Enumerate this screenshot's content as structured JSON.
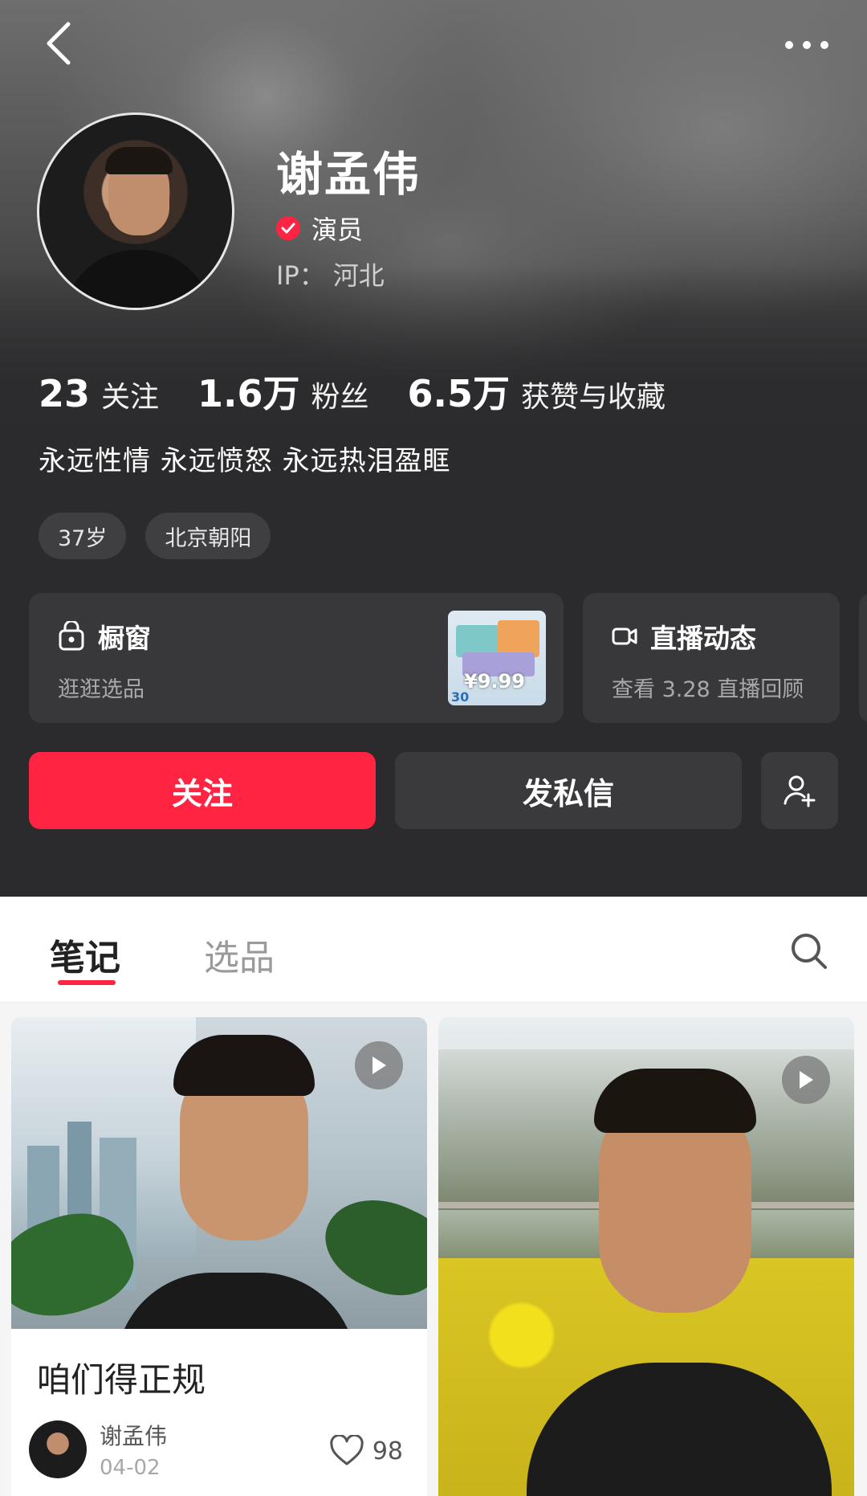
{
  "profile": {
    "name": "谢孟伟",
    "role": "演员",
    "ip_label": "IP：",
    "ip_value": "河北",
    "bio": "永远性情 永远愤怒 永远热泪盈眶",
    "tags": [
      "37岁",
      "北京朝阳"
    ]
  },
  "stats": [
    {
      "num": "23",
      "label": "关注"
    },
    {
      "num": "1.6万",
      "label": "粉丝"
    },
    {
      "num": "6.5万",
      "label": "获赞与收藏"
    }
  ],
  "cards": {
    "shop": {
      "title": "橱窗",
      "subtitle": "逛逛选品",
      "price": "¥9.99",
      "product_text": "30"
    },
    "live": {
      "title": "直播动态",
      "subtitle": "查看 3.28 直播回顾"
    }
  },
  "actions": {
    "follow": "关注",
    "message": "发私信"
  },
  "tabs": [
    {
      "label": "笔记",
      "active": true
    },
    {
      "label": "选品",
      "active": false
    }
  ],
  "notes": [
    {
      "title": "咱们得正规",
      "author": "谢孟伟",
      "date": "04-02",
      "likes": "98"
    }
  ],
  "colors": {
    "accent": "#ff2442",
    "header_bg": "#2b2b2d"
  },
  "icons": [
    "back-arrow-icon",
    "more-dots-icon",
    "verified-icon",
    "shop-bag-icon",
    "video-camera-icon",
    "add-friend-icon",
    "search-icon",
    "play-icon",
    "heart-icon"
  ]
}
